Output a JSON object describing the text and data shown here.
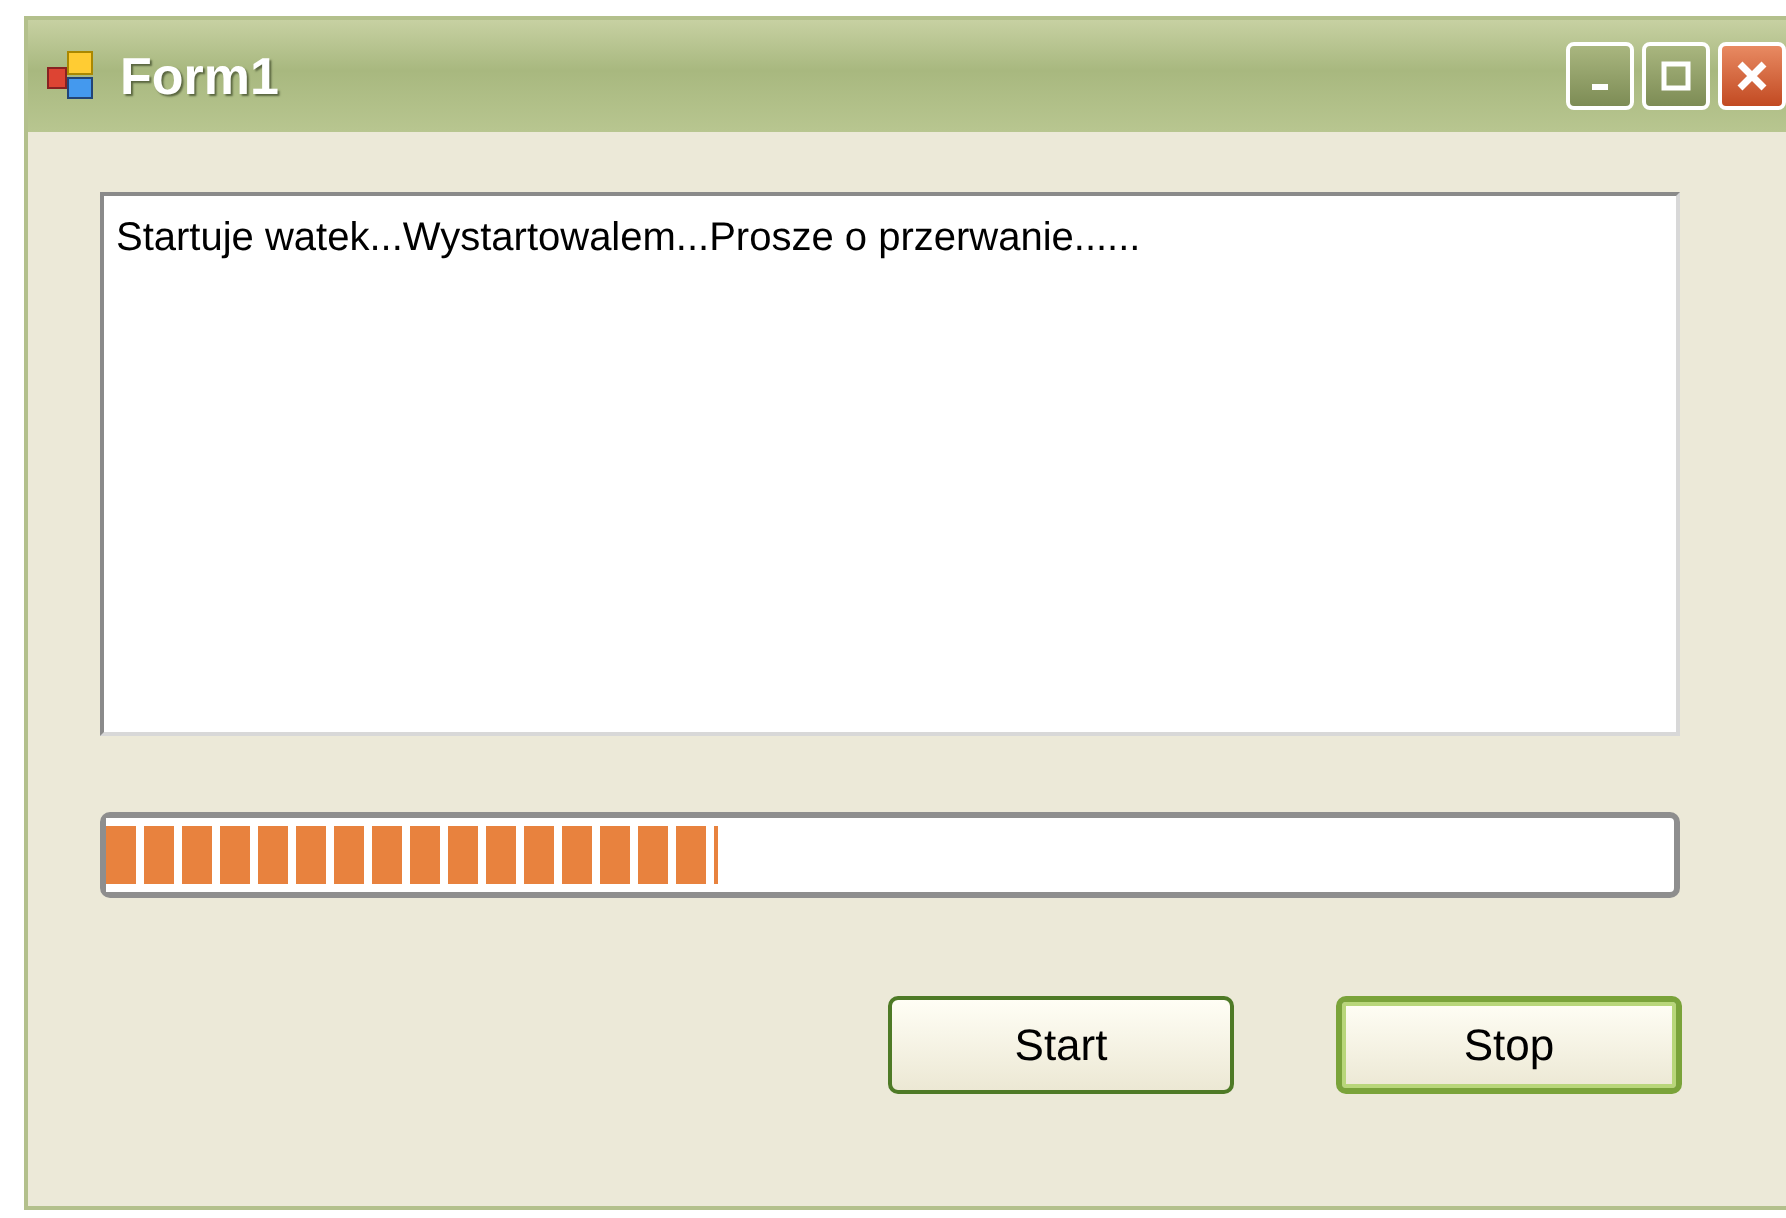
{
  "window": {
    "title": "Form1"
  },
  "log_text": "Startuje watek...Wystartowalem...Prosze o przerwanie......",
  "progress": {
    "level": 0.39
  },
  "buttons": [
    {
      "label": "Start",
      "default": false
    },
    {
      "label": "Stop",
      "default": true
    }
  ]
}
